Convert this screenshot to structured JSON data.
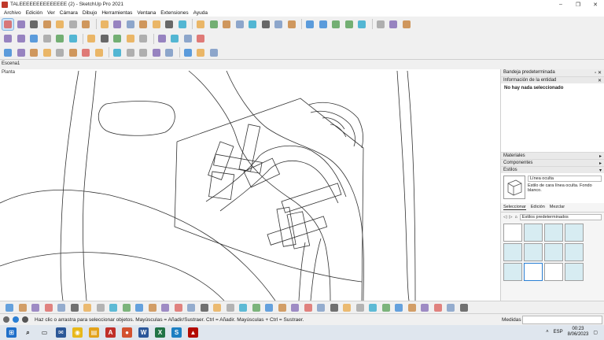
{
  "window": {
    "title": "TALEEEEEEEEEEEEEE (2) - SketchUp Pro 2021",
    "minimize": "–",
    "maximize": "❐",
    "close": "✕"
  },
  "menu": [
    "Archivo",
    "Edición",
    "Ver",
    "Cámara",
    "Dibujo",
    "Herramientas",
    "Ventana",
    "Extensiones",
    "Ayuda"
  ],
  "toolbars": {
    "row1": [
      "select-tool",
      "eraser-tool",
      "line-tool",
      "arc-tool",
      "shape-tool",
      "push-pull-tool",
      "move-tool",
      "rotate-tool",
      "scale-tool",
      "offset-tool",
      "tape-measure-tool",
      "text-tool",
      "axes-tool",
      "paint-bucket-tool",
      "orbit-tool",
      "pan-tool",
      "zoom-tool",
      "zoom-extents-tool",
      "sandbox-tool",
      "sandbox-stamp-tool",
      "section-plane-tool",
      "warehouse-tool",
      "extension-warehouse-tool",
      "styles-tool",
      "shadow-tool",
      "fog-tool",
      "iso-view",
      "top-view",
      "front-view",
      "right-view"
    ],
    "row2": [
      "component-tool",
      "solid-union",
      "solid-subtract",
      "solid-trim",
      "solid-split",
      "outer-shell",
      "intersect-tool",
      "follow-me-tool",
      "flip-tool",
      "camera-position",
      "walk-tool",
      "look-around",
      "house-view",
      "back-view",
      "left-view"
    ],
    "row3": [
      "curve-tool",
      "bezier-tool",
      "spline-tool",
      "polyline-tool",
      "arc-3pt",
      "ellipse-tool",
      "freehand-tool",
      "fillet-tool",
      "chamfer-tool",
      "extrude-tool",
      "weld-tool",
      "divide-tool",
      "terrain-tool",
      "smooth-tool",
      "layer-tool",
      "material-tool"
    ]
  },
  "scenes": {
    "tab": "Escena1"
  },
  "viewport": {
    "label": "Planta"
  },
  "tray": {
    "title": "Bandeja predeterminada",
    "entity_info": {
      "header": "Información de la entidad",
      "status": "No hay nada seleccionado"
    },
    "materials": "Materiales",
    "components": "Componentes",
    "styles": {
      "header": "Estilos",
      "name": "Línea oculta",
      "description": "Estilo de cara línea oculta. Fondo blanco.",
      "tabs": [
        "Seleccionar",
        "Edición",
        "Mezclar"
      ],
      "collection": "Estilos predeterminados"
    }
  },
  "status": {
    "hint": "Haz clic o arrastra para seleccionar objetos. Mayúsculas = Añadir/Sustraer. Ctrl = Añadir. Mayúsculas + Ctrl = Sustraer.",
    "measure_label": "Medidas"
  },
  "taskbar": {
    "apps": [
      "windows-start",
      "search",
      "task-view",
      "mail",
      "chrome",
      "file-explorer",
      "acrobat",
      "word-alt",
      "word",
      "excel",
      "sketchup",
      "acrobat-pdf"
    ],
    "lang": "ESP",
    "time": "00:23",
    "date": "8/06/2023"
  },
  "colors": {
    "accent": "#2a7fd4",
    "selected": "#cde4f7",
    "toolbar_bg": "#f0f0f0"
  }
}
